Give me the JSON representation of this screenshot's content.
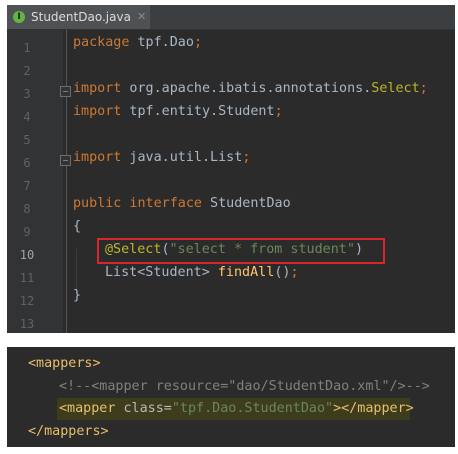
{
  "tab": {
    "title": "StudentDao.java",
    "icon_letter": "I",
    "close_glyph": "✕"
  },
  "line_numbers": [
    "1",
    "2",
    "3",
    "4",
    "5",
    "6",
    "7",
    "8",
    "9",
    "10",
    "11",
    "12",
    "13"
  ],
  "current_line": 10,
  "code": {
    "l1": {
      "kw": "package",
      "rest": " tpf.Dao",
      "semi": ";"
    },
    "l3": {
      "kw": "import",
      "pkg": " org.apache.ibatis.annotations.",
      "cls": "Select",
      "semi": ";"
    },
    "l4": {
      "kw": "import",
      "pkg": " tpf.entity.Student",
      "semi": ";"
    },
    "l6": {
      "kw": "import",
      "pkg": " java.util.List",
      "semi": ";"
    },
    "l8": {
      "kw1": "public",
      "kw2": " interface",
      "name": " StudentDao"
    },
    "l9": {
      "text": "{"
    },
    "l10": {
      "ann": "@Select",
      "open": "(",
      "str": "\"select * from student\"",
      "close": ")"
    },
    "l11": {
      "type": "List<Student> ",
      "fn": "findAll",
      "rest": "()",
      "semi": ";"
    },
    "l12": {
      "text": "}"
    }
  },
  "xml": {
    "l1": {
      "tag": "<mappers>"
    },
    "l2": {
      "comment": "<!--<mapper resource=\"dao/StudentDao.xml\"/>-->"
    },
    "l3": {
      "open": "<mapper",
      "attr": " class=",
      "val": "\"tpf.Dao.StudentDao\"",
      "close": "></mapper>"
    },
    "l4": {
      "tag": "</mappers>"
    }
  }
}
